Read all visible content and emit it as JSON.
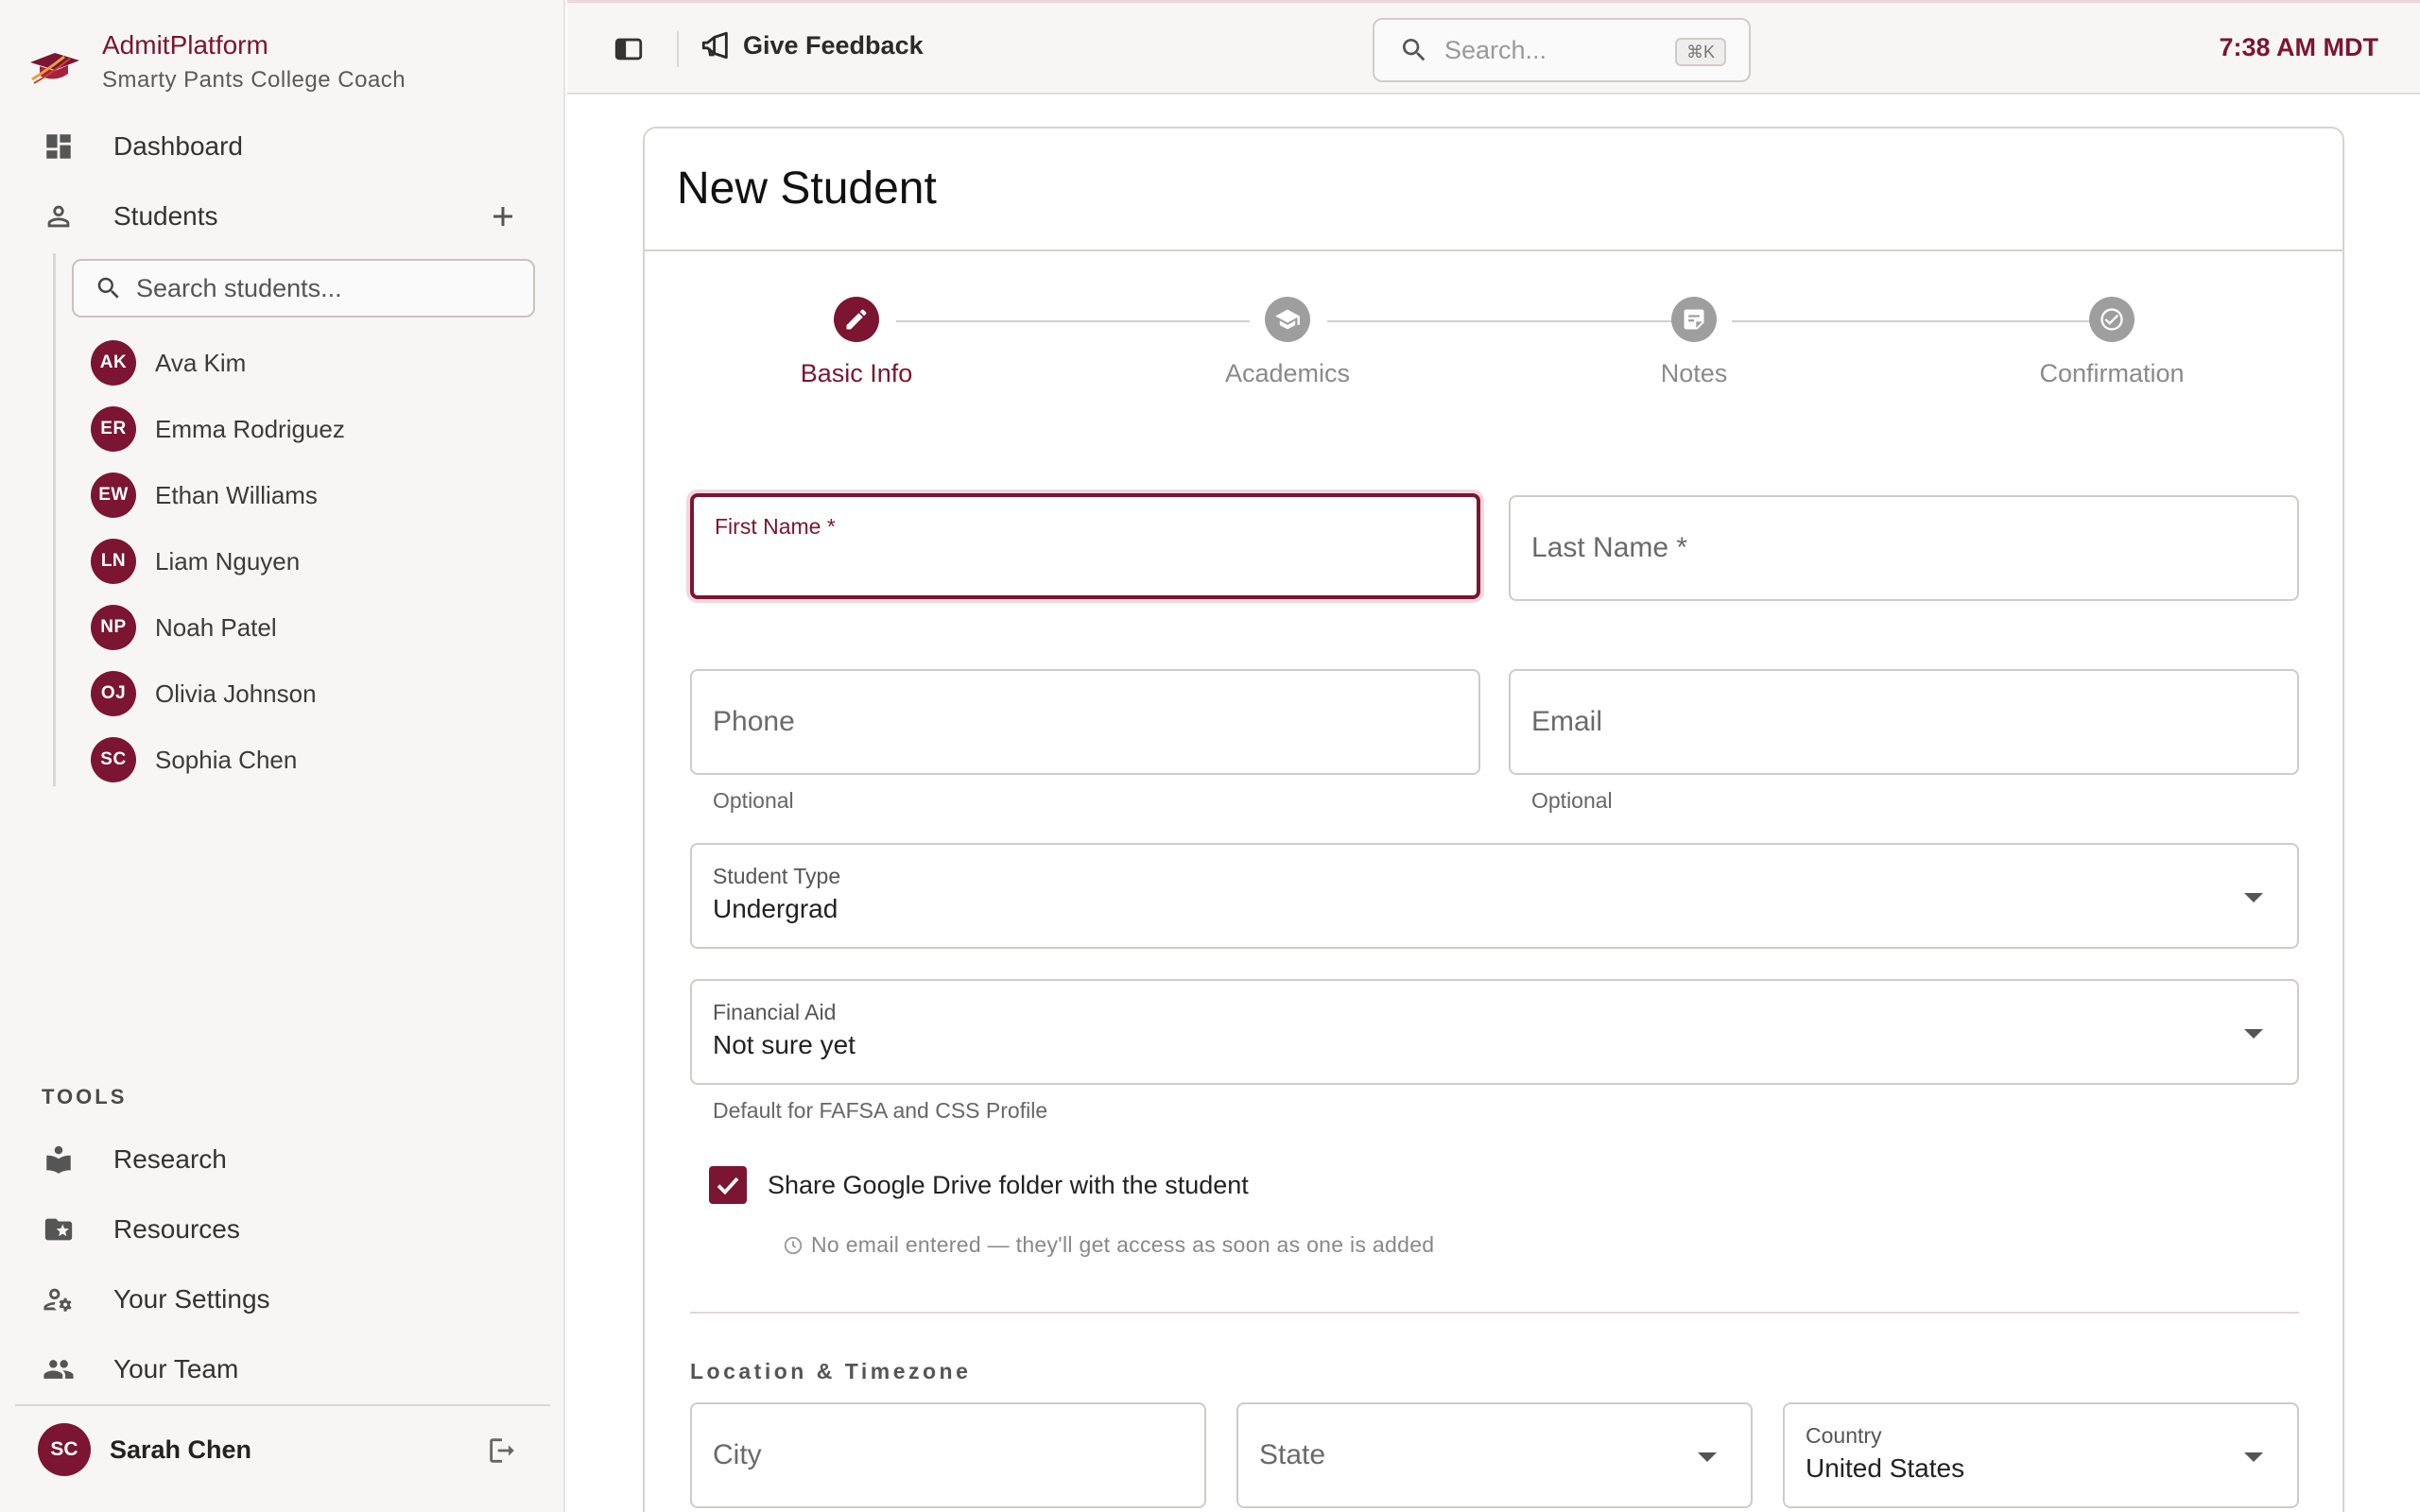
{
  "brand": {
    "name": "AdmitPlatform",
    "subtitle": "Smarty Pants College Coach"
  },
  "nav": {
    "dashboard": "Dashboard",
    "students": "Students"
  },
  "student_search": {
    "placeholder": "Search students..."
  },
  "students": [
    {
      "initials": "AK",
      "name": "Ava Kim"
    },
    {
      "initials": "ER",
      "name": "Emma Rodriguez"
    },
    {
      "initials": "EW",
      "name": "Ethan Williams"
    },
    {
      "initials": "LN",
      "name": "Liam Nguyen"
    },
    {
      "initials": "NP",
      "name": "Noah Patel"
    },
    {
      "initials": "OJ",
      "name": "Olivia Johnson"
    },
    {
      "initials": "SC",
      "name": "Sophia Chen"
    }
  ],
  "tools": {
    "label": "TOOLS",
    "items": [
      "Research",
      "Resources",
      "Your Settings",
      "Your Team"
    ]
  },
  "user": {
    "initials": "SC",
    "name": "Sarah Chen"
  },
  "topbar": {
    "feedback": "Give Feedback",
    "search_placeholder": "Search...",
    "shortcut": "⌘K",
    "time": "7:38 AM MDT"
  },
  "form": {
    "title": "New Student",
    "steps": [
      "Basic Info",
      "Academics",
      "Notes",
      "Confirmation"
    ],
    "first_name_label": "First Name *",
    "last_name_label": "Last Name *",
    "phone_label": "Phone",
    "phone_helper": "Optional",
    "email_label": "Email",
    "email_helper": "Optional",
    "student_type": {
      "label": "Student Type",
      "value": "Undergrad"
    },
    "financial_aid": {
      "label": "Financial Aid",
      "value": "Not sure yet",
      "helper": "Default for FAFSA and CSS Profile"
    },
    "share_drive": {
      "label": "Share Google Drive folder with the student",
      "checked": true,
      "note": "No email entered — they'll get access as soon as one is added"
    },
    "location_section": "Location & Timezone",
    "city_label": "City",
    "state_label": "State",
    "country": {
      "label": "Country",
      "value": "United States"
    }
  },
  "colors": {
    "accent": "#7b1532",
    "sidebar_bg": "#f7f6f5",
    "inactive_step": "#9e9e9e"
  }
}
